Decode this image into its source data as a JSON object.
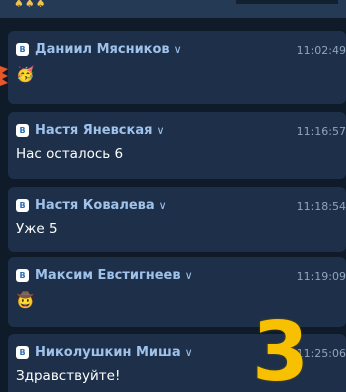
{
  "top": {
    "emojis": "♠♠♠"
  },
  "messages": [
    {
      "author": "Даниил Мясников",
      "chevron": "∨",
      "time": "11:02:49",
      "text": "🥳"
    },
    {
      "author": "Настя Яневская",
      "chevron": "∨",
      "time": "11:16:57",
      "text": "Нас осталось 6"
    },
    {
      "author": "Настя Ковалева",
      "chevron": "∨",
      "time": "11:18:54",
      "text": "Уже 5"
    },
    {
      "author": "Максим Евстигнеев",
      "chevron": "∨",
      "time": "11:19:09",
      "text": "🤠"
    },
    {
      "author": "Николушкин Миша",
      "chevron": "∨",
      "time": "11:25:06",
      "text": "Здравствуйте!"
    }
  ],
  "platform_badge": "В",
  "overlay": {
    "number": "3",
    "color": "#f7c000"
  },
  "colors": {
    "background": "#0f1b29",
    "card": "#1e3049",
    "author": "#9fc2eb",
    "time": "#8fa5bf",
    "text": "#ffffff",
    "left_sliver": "#e8572a"
  }
}
